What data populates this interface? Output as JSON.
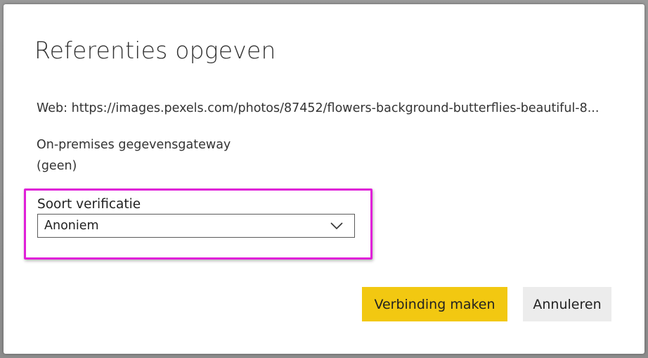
{
  "dialog": {
    "title": "Referenties opgeven",
    "source_text": "Web: https://images.pexels.com/photos/87452/flowers-background-butterflies-beautiful-8...",
    "gateway_label": "On-premises gegevensgateway",
    "gateway_value": "(geen)",
    "auth": {
      "label": "Soort verificatie",
      "selected": "Anoniem"
    },
    "buttons": {
      "connect": "Verbinding maken",
      "cancel": "Annuleren"
    }
  },
  "colors": {
    "primary_button": "#f2c811",
    "secondary_button": "#ececec",
    "highlight_border": "#e020d8"
  },
  "icons": {
    "dropdown": "chevron-down-icon"
  }
}
